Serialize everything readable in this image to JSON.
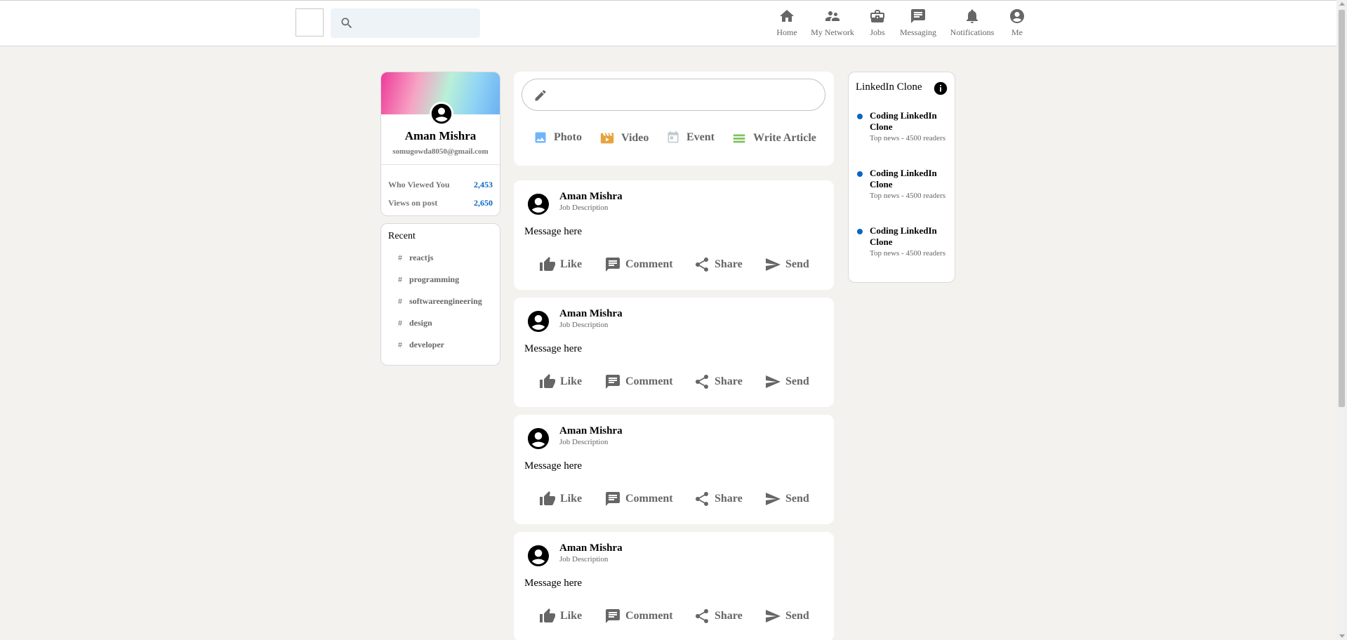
{
  "header": {
    "nav": [
      {
        "label": "Home",
        "icon": "home-icon"
      },
      {
        "label": "My Network",
        "icon": "network-icon"
      },
      {
        "label": "Jobs",
        "icon": "briefcase-icon"
      },
      {
        "label": "Messaging",
        "icon": "chat-icon"
      },
      {
        "label": "Notifications",
        "icon": "bell-icon"
      },
      {
        "label": "Me",
        "icon": "account-icon"
      }
    ]
  },
  "sidebar": {
    "profile": {
      "name": "Aman Mishra",
      "email": "somugowda8050@gmail.com",
      "stats": [
        {
          "label": "Who Viewed You",
          "value": "2,453"
        },
        {
          "label": "Views on post",
          "value": "2,650"
        }
      ]
    },
    "recent": {
      "title": "Recent",
      "tags": [
        "reactjs",
        "programming",
        "softwareengineering",
        "design",
        "developer"
      ]
    }
  },
  "composer": {
    "options": [
      {
        "label": "Photo",
        "icon": "image-icon",
        "color": "#70b5f9"
      },
      {
        "label": "Video",
        "icon": "video-icon",
        "color": "#e7a33e"
      },
      {
        "label": "Event",
        "icon": "calendar-icon",
        "color": "#c0cbcd"
      },
      {
        "label": "Write Article",
        "icon": "article-icon",
        "color": "#7fc15e"
      }
    ]
  },
  "posts": [
    {
      "name": "Aman Mishra",
      "description": "Job Description",
      "message": "Message here"
    },
    {
      "name": "Aman Mishra",
      "description": "Job Description",
      "message": "Message here"
    },
    {
      "name": "Aman Mishra",
      "description": "Job Description",
      "message": "Message here"
    },
    {
      "name": "Aman Mishra",
      "description": "Job Description",
      "message": "Message here"
    }
  ],
  "post_actions": [
    "Like",
    "Comment",
    "Share",
    "Send"
  ],
  "widgets": {
    "title": "LinkedIn Clone",
    "news": [
      {
        "heading": "Coding LinkedIn Clone",
        "subtitle": "Top news - 4500 readers"
      },
      {
        "heading": "Coding LinkedIn Clone",
        "subtitle": "Top news - 4500 readers"
      },
      {
        "heading": "Coding LinkedIn Clone",
        "subtitle": "Top news - 4500 readers"
      }
    ]
  },
  "colors": {
    "accent": "#0a66c2",
    "background": "#f3f2ef",
    "icon_gray": "#666666"
  }
}
